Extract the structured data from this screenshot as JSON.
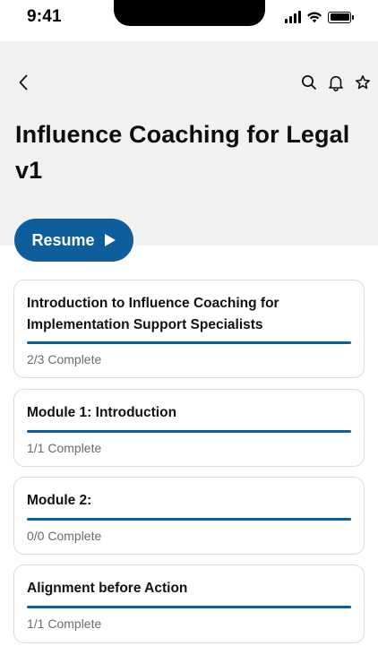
{
  "status_bar": {
    "time": "9:41"
  },
  "header": {
    "back_icon": "chevron-left-icon",
    "actions": [
      "search-icon",
      "bell-icon",
      "star-icon"
    ],
    "title": "Influence Coaching for Legal v1"
  },
  "resume": {
    "label": "Resume",
    "icon": "play-icon"
  },
  "modules": [
    {
      "title": "Introduction to Influence Coaching for Implementation Support Specialists",
      "status": "2/3 Complete",
      "progress": 1.0
    },
    {
      "title": "Module 1: Introduction",
      "status": "1/1 Complete",
      "progress": 1.0
    },
    {
      "title": "Module 2:",
      "status": "0/0 Complete",
      "progress": 1.0
    },
    {
      "title": "Alignment before Action",
      "status": "1/1 Complete",
      "progress": 1.0
    }
  ],
  "colors": {
    "accent": "#0e5e9c",
    "header_bg": "#f1f1f1",
    "card_border": "#dcdcdc",
    "muted_text": "#6b6b6b"
  }
}
